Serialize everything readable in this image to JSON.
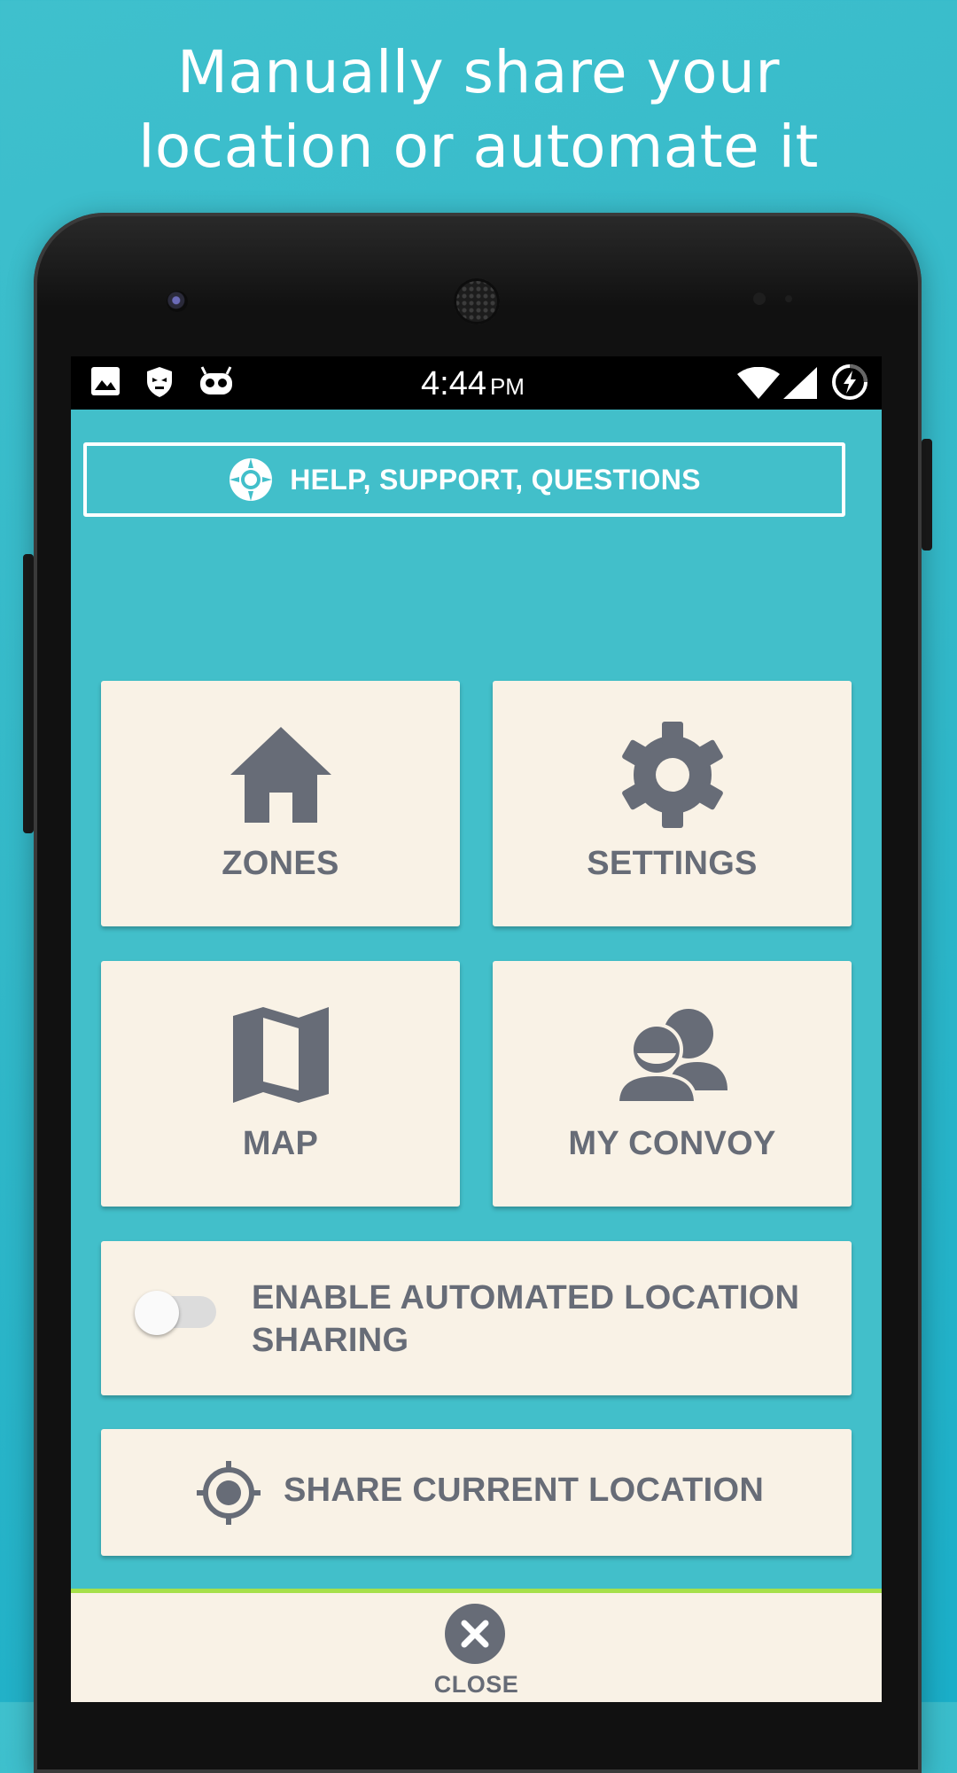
{
  "promo": {
    "line1": "Manually share your",
    "line2": "location or automate it"
  },
  "status_bar": {
    "time": "4:44",
    "ampm": "PM",
    "icons_left": [
      "image-icon",
      "shield-icon",
      "robot-icon"
    ],
    "icons_right": [
      "wifi-icon",
      "signal-icon",
      "battery-charging-icon"
    ]
  },
  "help_button": {
    "label": "HELP, SUPPORT, QUESTIONS",
    "icon": "lifebuoy-icon"
  },
  "tiles": [
    {
      "label": "ZONES",
      "icon": "home-icon"
    },
    {
      "label": "SETTINGS",
      "icon": "gear-icon"
    },
    {
      "label": "MAP",
      "icon": "map-icon"
    },
    {
      "label": "MY CONVOY",
      "icon": "people-icon"
    }
  ],
  "automated_sharing": {
    "label_line1": "ENABLE AUTOMATED LOCATION",
    "label_line2": "SHARING",
    "enabled": false
  },
  "share_location": {
    "label": "SHARE CURRENT LOCATION",
    "icon": "crosshair-icon"
  },
  "close": {
    "label": "CLOSE",
    "icon": "close-icon"
  },
  "colors": {
    "background": "#3fc0cd",
    "screen": "#42bfca",
    "tile": "#f9f2e6",
    "tile_text": "#676c77",
    "accent_line": "#a6e04a"
  }
}
